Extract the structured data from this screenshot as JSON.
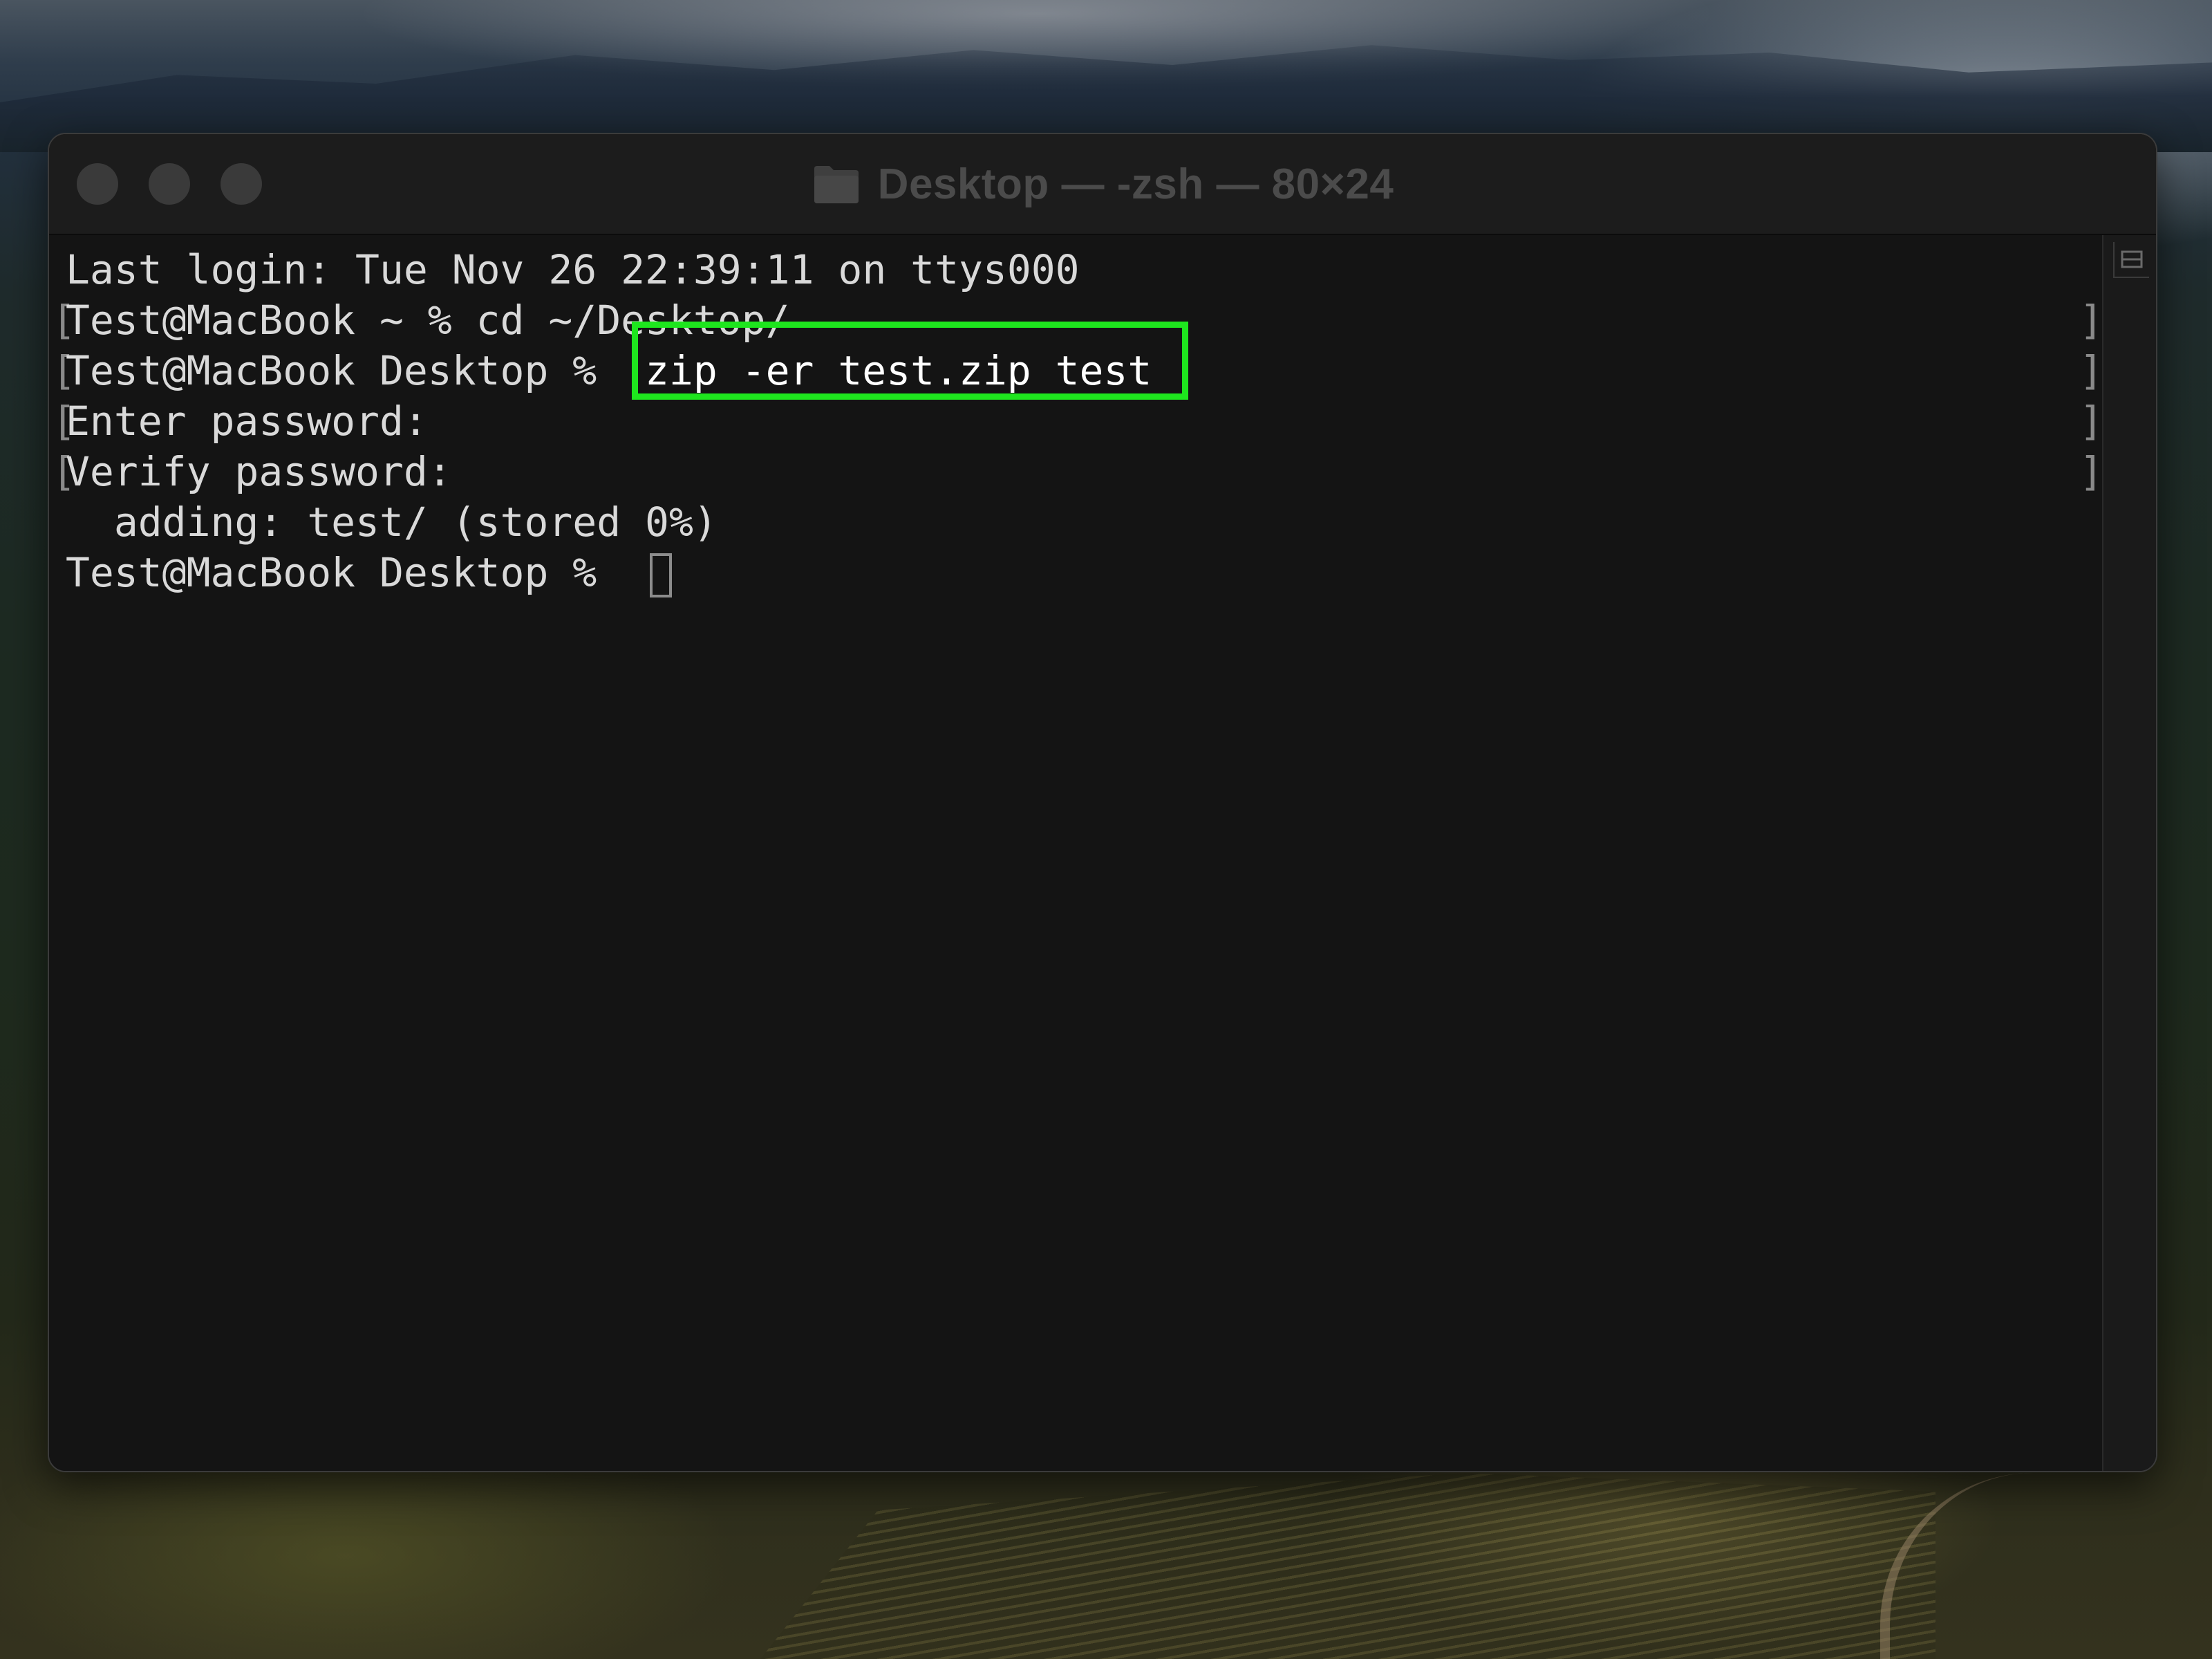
{
  "window": {
    "title": "Desktop — -zsh — 80×24",
    "title_icon": "folder-icon"
  },
  "terminal": {
    "lines": [
      {
        "text": "Last login: Tue Nov 26 22:39:11 on ttys000",
        "marked": false
      },
      {
        "text": "Test@MacBook ~ % cd ~/Desktop/",
        "marked": true
      },
      {
        "prompt": "Test@MacBook Desktop %",
        "command": "zip -er test.zip test",
        "marked": true
      },
      {
        "text": "Enter password:",
        "marked": true
      },
      {
        "text": "Verify password:",
        "marked": true
      },
      {
        "text": "  adding: test/ (stored 0%)",
        "marked": false
      },
      {
        "text": "Test@MacBook Desktop %",
        "marked": false
      }
    ],
    "mark_open": "[",
    "mark_close": "]",
    "highlight_color": "#1ee61e"
  },
  "colors": {
    "terminal_bg": "#141414",
    "terminal_text": "#d9d9d9",
    "titlebar_bg": "#1c1c1c"
  }
}
